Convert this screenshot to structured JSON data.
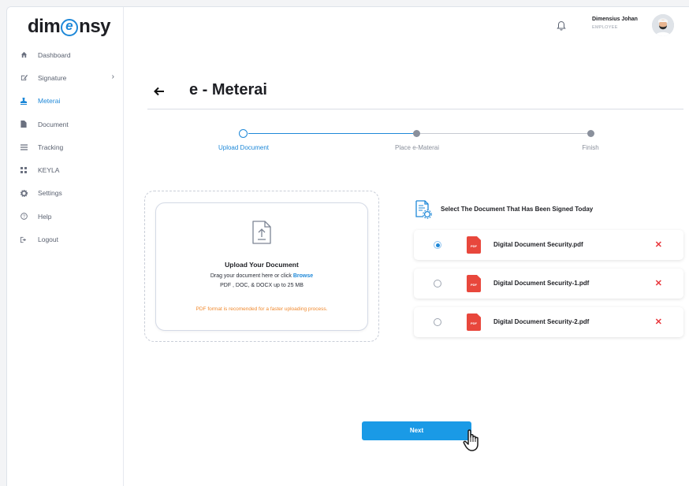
{
  "app": {
    "logo_text": "dimensy"
  },
  "sidebar": {
    "items": [
      {
        "label": "Dashboard",
        "icon": "home-icon",
        "active": false
      },
      {
        "label": "Signature",
        "icon": "pen-icon",
        "active": false,
        "has_submenu": true
      },
      {
        "label": "Meterai",
        "icon": "stamp-icon",
        "active": true
      },
      {
        "label": "Document",
        "icon": "file-icon",
        "active": false
      },
      {
        "label": "Tracking",
        "icon": "list-icon",
        "active": false
      },
      {
        "label": "KEYLA",
        "icon": "grid-icon",
        "active": false
      },
      {
        "label": "Settings",
        "icon": "gear-icon",
        "active": false
      },
      {
        "label": "Help",
        "icon": "help-icon",
        "active": false
      },
      {
        "label": "Logout",
        "icon": "logout-icon",
        "active": false
      }
    ]
  },
  "header": {
    "user_name": "Dimensius Johan",
    "user_role": "EMPLOYEE"
  },
  "page": {
    "title": "e - Meterai"
  },
  "stepper": {
    "steps": [
      {
        "label": "Upload Document",
        "state": "current"
      },
      {
        "label": "Place e-Materai",
        "state": "pending"
      },
      {
        "label": "Finish",
        "state": "pending"
      }
    ]
  },
  "upload": {
    "title": "Upload Your Document",
    "line1_prefix": "Drag your document here or click",
    "browse_label": "Browse",
    "line2": "PDF , DOC, & DOCX up to 25 MB",
    "note": "PDF format is recomended for a faster uploading process."
  },
  "documents": {
    "heading": "Select The Document That Has Been Signed Today",
    "file_badge": "PDF",
    "items": [
      {
        "name": "Digital Document Security.pdf",
        "selected": true
      },
      {
        "name": "Digital Document Security-1.pdf",
        "selected": false
      },
      {
        "name": "Digital Document Security-2.pdf",
        "selected": false
      }
    ]
  },
  "actions": {
    "next_label": "Next"
  },
  "colors": {
    "accent": "#1e88d8",
    "button": "#1a9ae6",
    "warning": "#f0892e",
    "danger": "#e8353a",
    "pdf": "#e8473c"
  }
}
